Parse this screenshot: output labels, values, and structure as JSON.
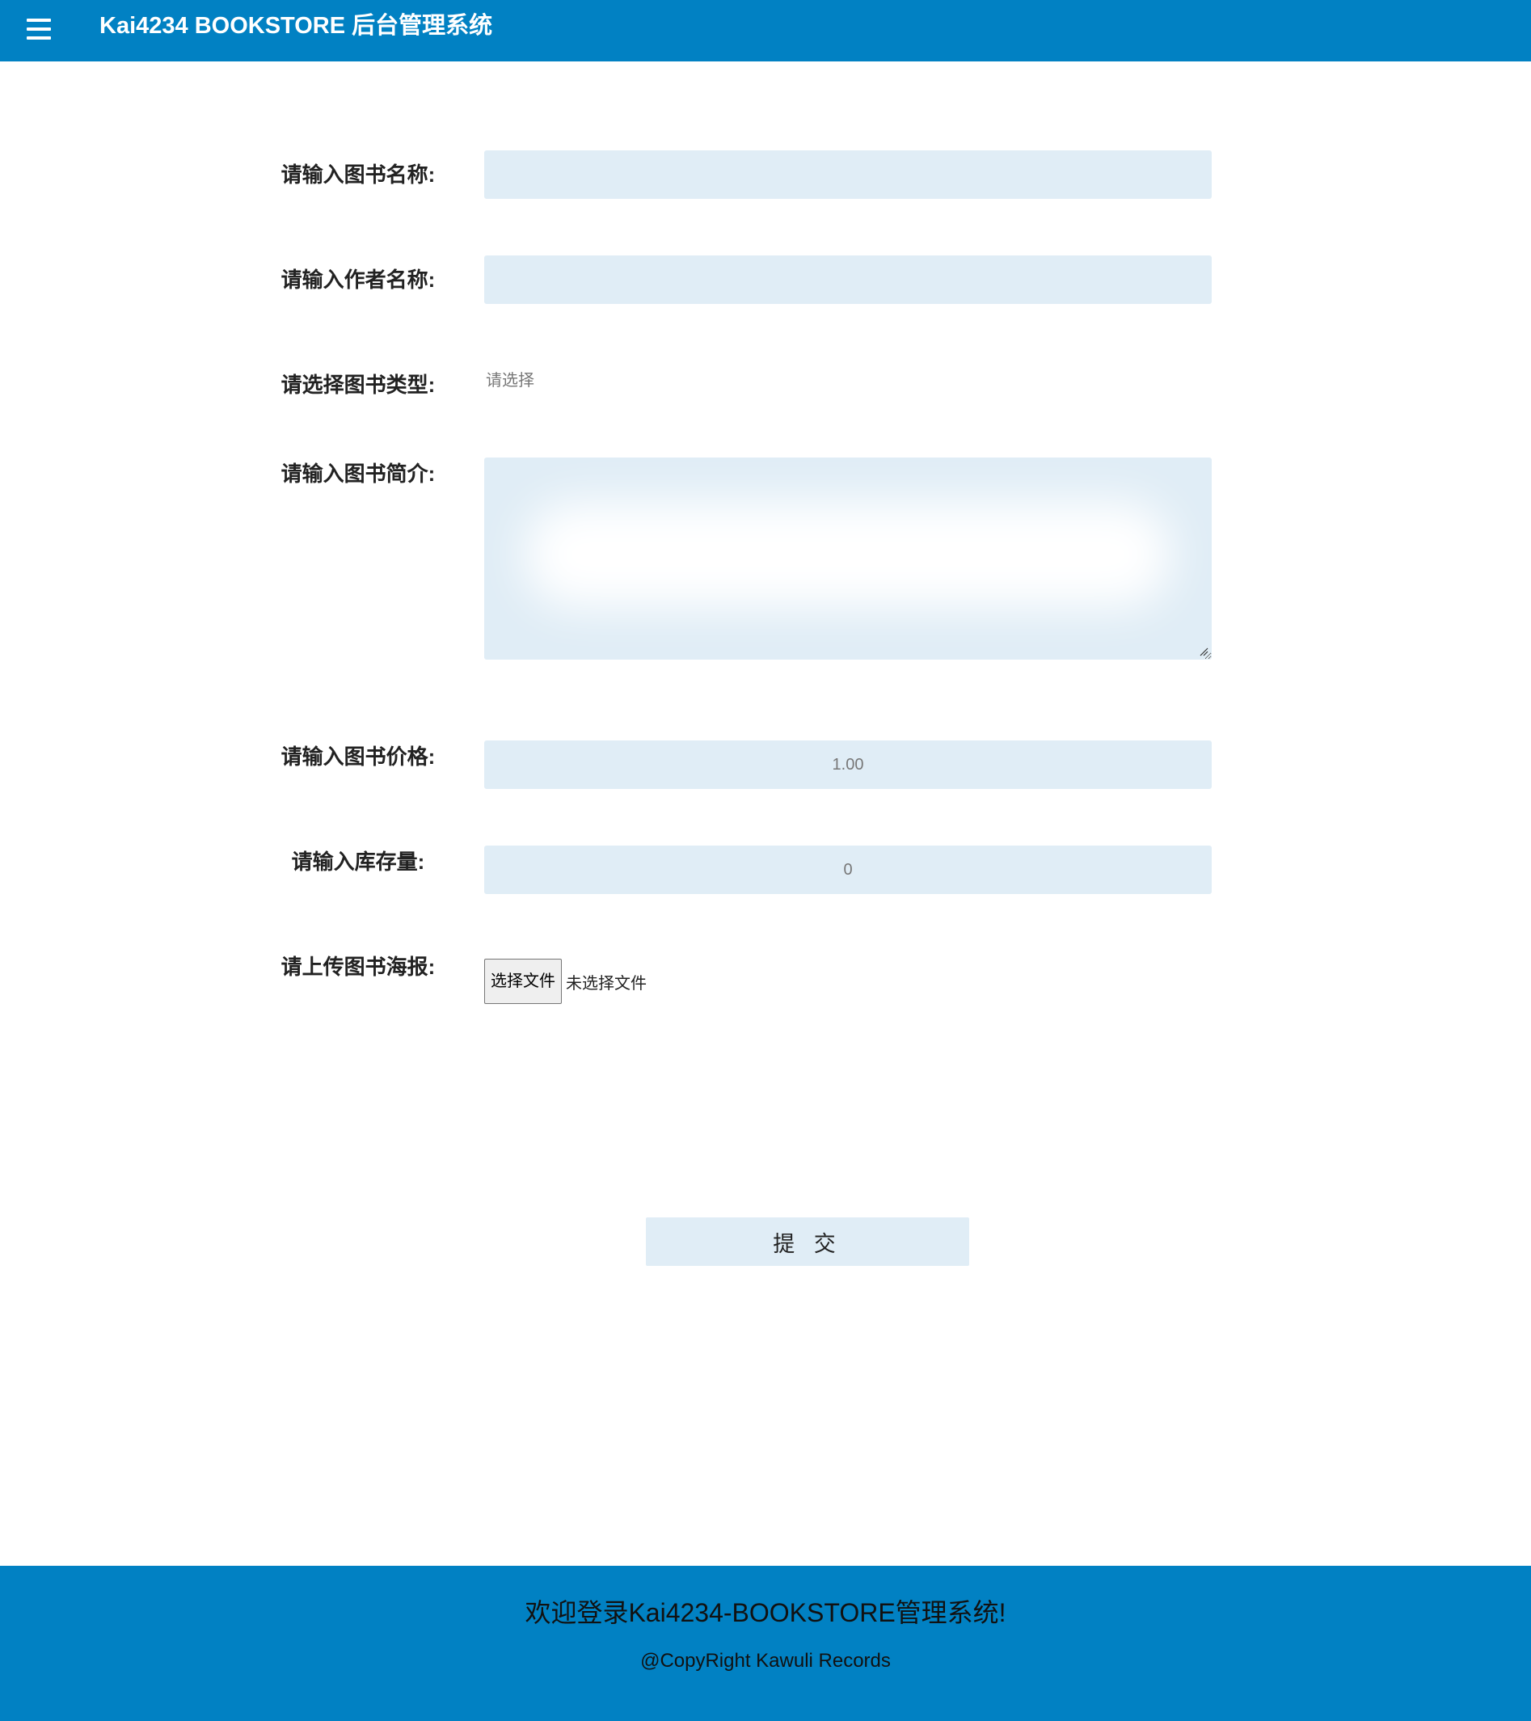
{
  "header": {
    "title": "Kai4234 BOOKSTORE 后台管理系统",
    "menu_icon": "hamburger-menu-icon",
    "background_color": "#0181c3"
  },
  "form": {
    "book_name": {
      "label": "请输入图书名称:",
      "value": "",
      "placeholder": ""
    },
    "author_name": {
      "label": "请输入作者名称:",
      "value": "",
      "placeholder": ""
    },
    "book_type": {
      "label": "请选择图书类型:",
      "selected": "请选择"
    },
    "description": {
      "label": "请输入图书简介:",
      "value": ""
    },
    "price": {
      "label": "请输入图书价格:",
      "value": "",
      "placeholder": "1.00"
    },
    "stock": {
      "label": "请输入库存量:",
      "value": "",
      "placeholder": "0"
    },
    "poster": {
      "label": "请上传图书海报:",
      "button_label": "选择文件",
      "status": "未选择文件"
    },
    "submit_label": "提 交",
    "field_color": "#e0edf6"
  },
  "footer": {
    "welcome": "欢迎登录Kai4234-BOOKSTORE管理系统!",
    "copyright": "@CopyRight Kawuli Records"
  }
}
